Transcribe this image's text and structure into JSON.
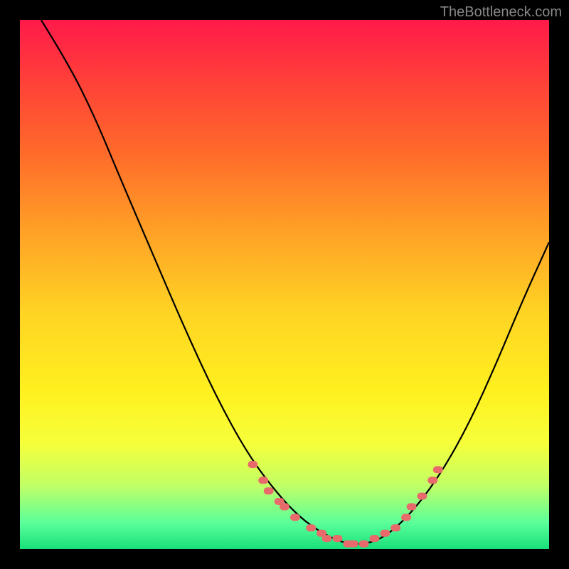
{
  "watermark": "TheBottleneck.com",
  "chart_data": {
    "type": "line",
    "title": "",
    "xlabel": "",
    "ylabel": "",
    "xlim": [
      0,
      100
    ],
    "ylim": [
      0,
      100
    ],
    "curve": {
      "name": "bottleneck-curve",
      "points": [
        {
          "x": 4,
          "y": 100
        },
        {
          "x": 9,
          "y": 92
        },
        {
          "x": 14,
          "y": 82
        },
        {
          "x": 19,
          "y": 70
        },
        {
          "x": 25,
          "y": 56
        },
        {
          "x": 31,
          "y": 42
        },
        {
          "x": 37,
          "y": 29
        },
        {
          "x": 43,
          "y": 18
        },
        {
          "x": 49,
          "y": 10
        },
        {
          "x": 54,
          "y": 5
        },
        {
          "x": 59,
          "y": 2
        },
        {
          "x": 62,
          "y": 1
        },
        {
          "x": 66,
          "y": 1
        },
        {
          "x": 70,
          "y": 3
        },
        {
          "x": 75,
          "y": 8
        },
        {
          "x": 80,
          "y": 15
        },
        {
          "x": 85,
          "y": 24
        },
        {
          "x": 90,
          "y": 35
        },
        {
          "x": 95,
          "y": 47
        },
        {
          "x": 100,
          "y": 58
        }
      ]
    },
    "markers": {
      "name": "highlighted-range",
      "points": [
        {
          "x": 44,
          "y": 16
        },
        {
          "x": 46,
          "y": 13
        },
        {
          "x": 47,
          "y": 11
        },
        {
          "x": 49,
          "y": 9
        },
        {
          "x": 50,
          "y": 8
        },
        {
          "x": 52,
          "y": 6
        },
        {
          "x": 55,
          "y": 4
        },
        {
          "x": 57,
          "y": 3
        },
        {
          "x": 58,
          "y": 2
        },
        {
          "x": 60,
          "y": 2
        },
        {
          "x": 62,
          "y": 1
        },
        {
          "x": 63,
          "y": 1
        },
        {
          "x": 65,
          "y": 1
        },
        {
          "x": 67,
          "y": 2
        },
        {
          "x": 69,
          "y": 3
        },
        {
          "x": 71,
          "y": 4
        },
        {
          "x": 73,
          "y": 6
        },
        {
          "x": 74,
          "y": 8
        },
        {
          "x": 76,
          "y": 10
        },
        {
          "x": 78,
          "y": 13
        },
        {
          "x": 79,
          "y": 15
        }
      ]
    }
  },
  "colors": {
    "marker": "#e86a6a",
    "curve": "#000000"
  }
}
